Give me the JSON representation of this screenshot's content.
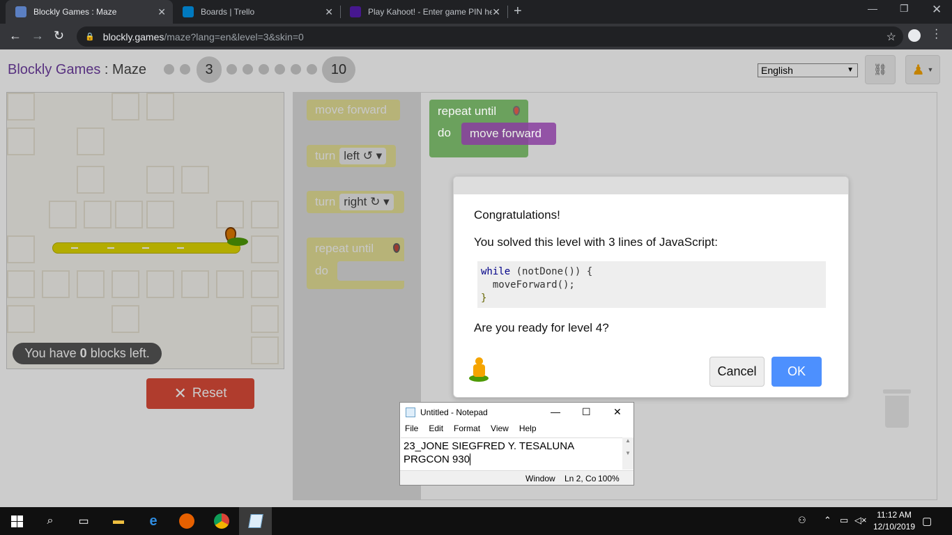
{
  "browser": {
    "tabs": [
      {
        "title": "Blockly Games : Maze",
        "active": true
      },
      {
        "title": "Boards | Trello",
        "active": false
      },
      {
        "title": "Play Kahoot! - Enter game PIN he",
        "active": false
      }
    ],
    "new_tab": "+",
    "url_host": "blockly.games",
    "url_path": "/maze?lang=en&level=3&skin=0"
  },
  "header": {
    "brand": "Blockly Games",
    "separator": " : ",
    "game": "Maze",
    "current_level": "3",
    "last_level": "10",
    "language": "English"
  },
  "maze": {
    "blocks_left_prefix": "You have ",
    "blocks_left_count": "0",
    "blocks_left_suffix": " blocks left.",
    "reset_label": "Reset",
    "reset_icon": "✕"
  },
  "toolbox": {
    "move_forward": "move forward",
    "turn_left": "turn",
    "turn_left_dd": "left ↺",
    "turn_right": "turn",
    "turn_right_dd": "right ↻",
    "repeat_until": "repeat until",
    "do": "do"
  },
  "workspace": {
    "repeat_until": "repeat until",
    "do": "do",
    "move_forward": "move forward"
  },
  "dialog": {
    "line1": "Congratulations!",
    "line2": "You solved this level with 3 lines of JavaScript:",
    "code_kw": "while",
    "code_rest1": " (notDone()) {",
    "code_line2": "  moveForward();",
    "code_line3": "}",
    "line3": "Are you ready for level 4?",
    "cancel": "Cancel",
    "ok": "OK"
  },
  "notepad": {
    "title": "Untitled - Notepad",
    "menu": [
      "File",
      "Edit",
      "Format",
      "View",
      "Help"
    ],
    "line1": "23_JONE SIEGFRED Y. TESALUNA",
    "line2": "PRGCON 930",
    "status_left": "Window",
    "status_pos": "Ln 2, Co",
    "status_zoom": "100%"
  },
  "taskbar": {
    "time": "11:12 AM",
    "date": "12/10/2019"
  },
  "colors": {
    "accent_purple": "#6e3ea0",
    "reset_red": "#dd4b39",
    "ok_blue": "#4d90fe",
    "loop_green": "#5b9a4a",
    "move_purple": "#8a3ea0"
  }
}
